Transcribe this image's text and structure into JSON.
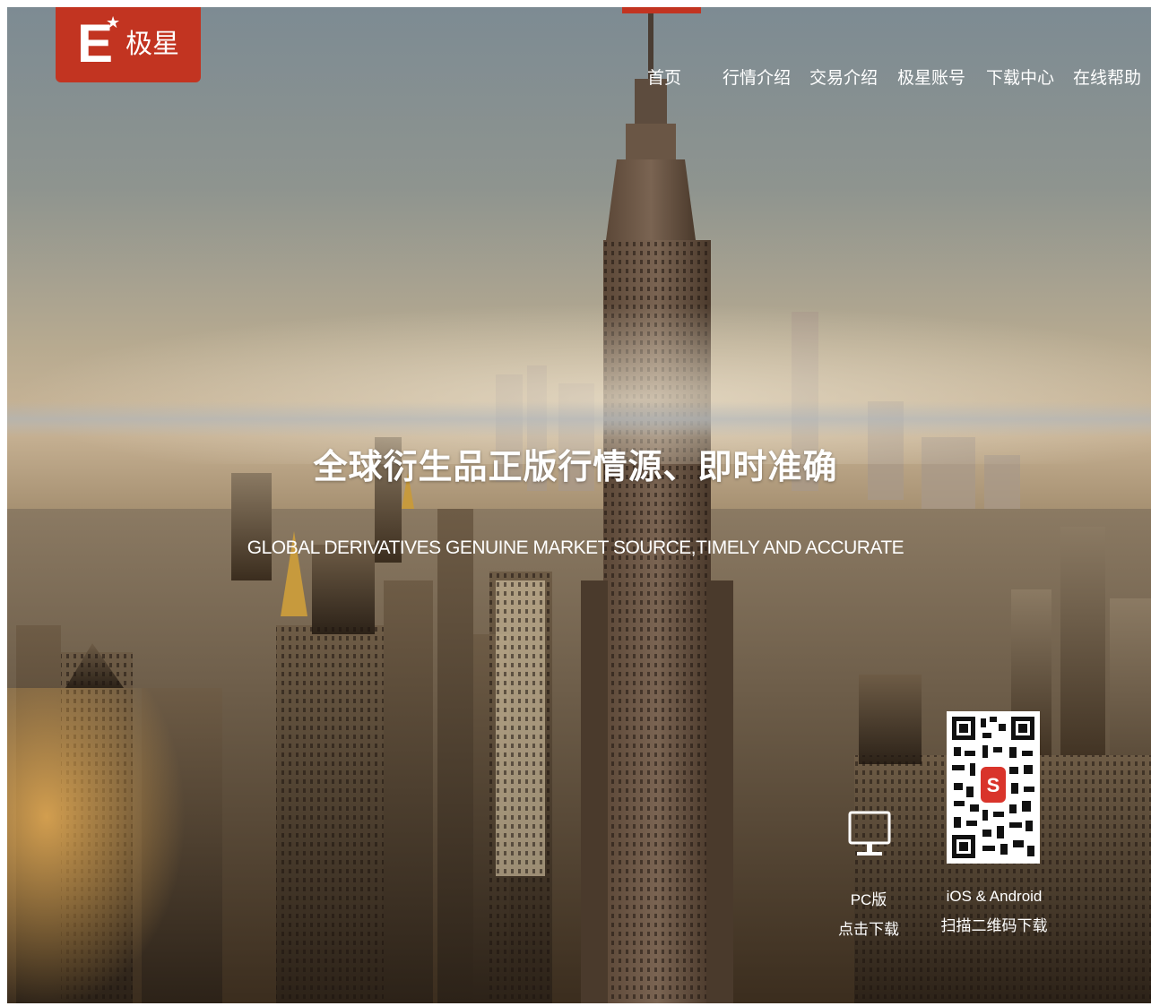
{
  "logo": {
    "mark": "E",
    "star": "★",
    "name": "极星",
    "color": "#c23421"
  },
  "nav": {
    "items": [
      "首页",
      "行情介绍",
      "交易介绍",
      "极星账号",
      "下载中心",
      "在线帮助"
    ],
    "active_index": 0,
    "accent_color": "#c23421"
  },
  "hero": {
    "headline": "全球衍生品正版行情源、即时准确",
    "subline": "GLOBAL DERIVATIVES GENUINE MARKET SOURCE,TIMELY AND ACCURATE"
  },
  "downloads": {
    "pc": {
      "line1": "PC版",
      "line2": "点击下载",
      "icon": "monitor-icon"
    },
    "mobile": {
      "line1": "iOS & Android",
      "line2": "扫描二维码下载",
      "icon": "qr-code-icon"
    }
  }
}
